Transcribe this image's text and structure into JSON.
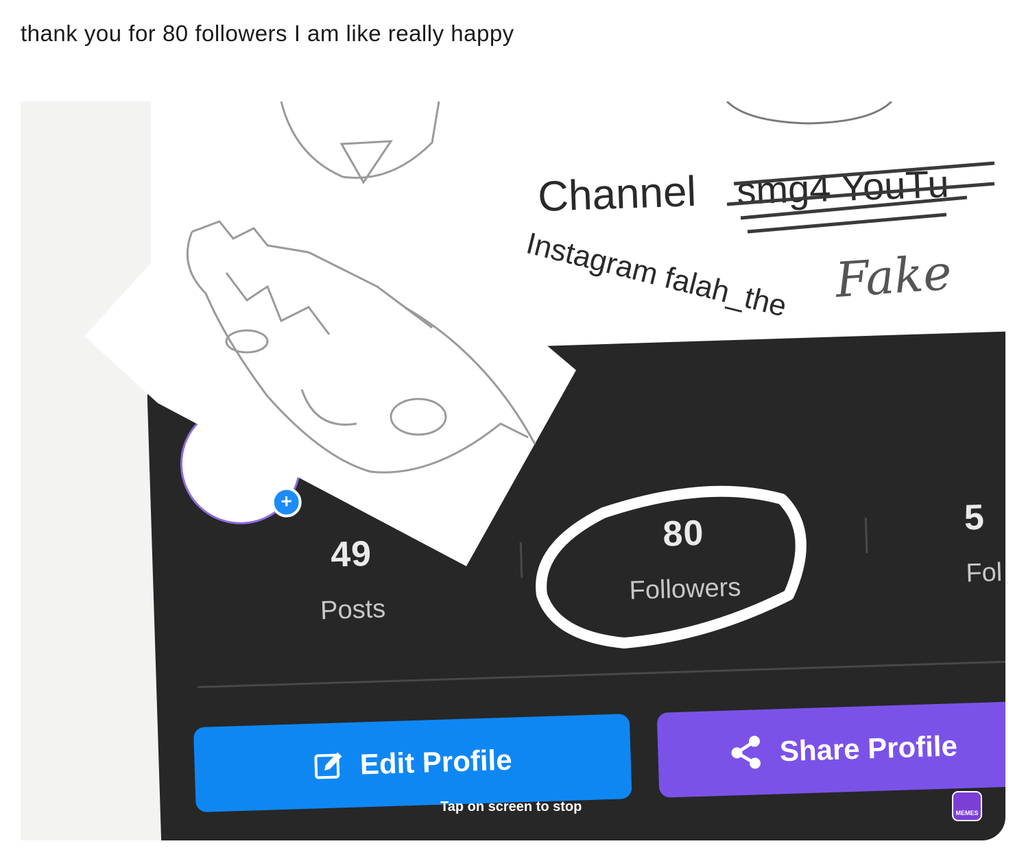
{
  "caption": "thank you for 80 followers I am like really happy",
  "sketch": {
    "channel_text": "Channel",
    "struck_text": "smg4 YouTu",
    "instagram_text": "Instagram falah_the",
    "fake_text": "Fake"
  },
  "profile": {
    "stats": [
      {
        "value": "49",
        "label": "Posts"
      },
      {
        "value": "80",
        "label": "Followers"
      },
      {
        "value": "5",
        "label": "Fol"
      }
    ],
    "edit_button_label": "Edit Profile",
    "share_button_label": "Share Profile",
    "avatar_add_glyph": "+"
  },
  "overlay_hint": "Tap on screen to stop",
  "watermark": "MEMES",
  "icons": [
    "edit-icon",
    "share-icon",
    "add-icon"
  ],
  "colors": {
    "card": "#272727",
    "edit_button": "#0f87f3",
    "share_button": "#7b52e8",
    "avatar_ring": "#8f6be6"
  }
}
